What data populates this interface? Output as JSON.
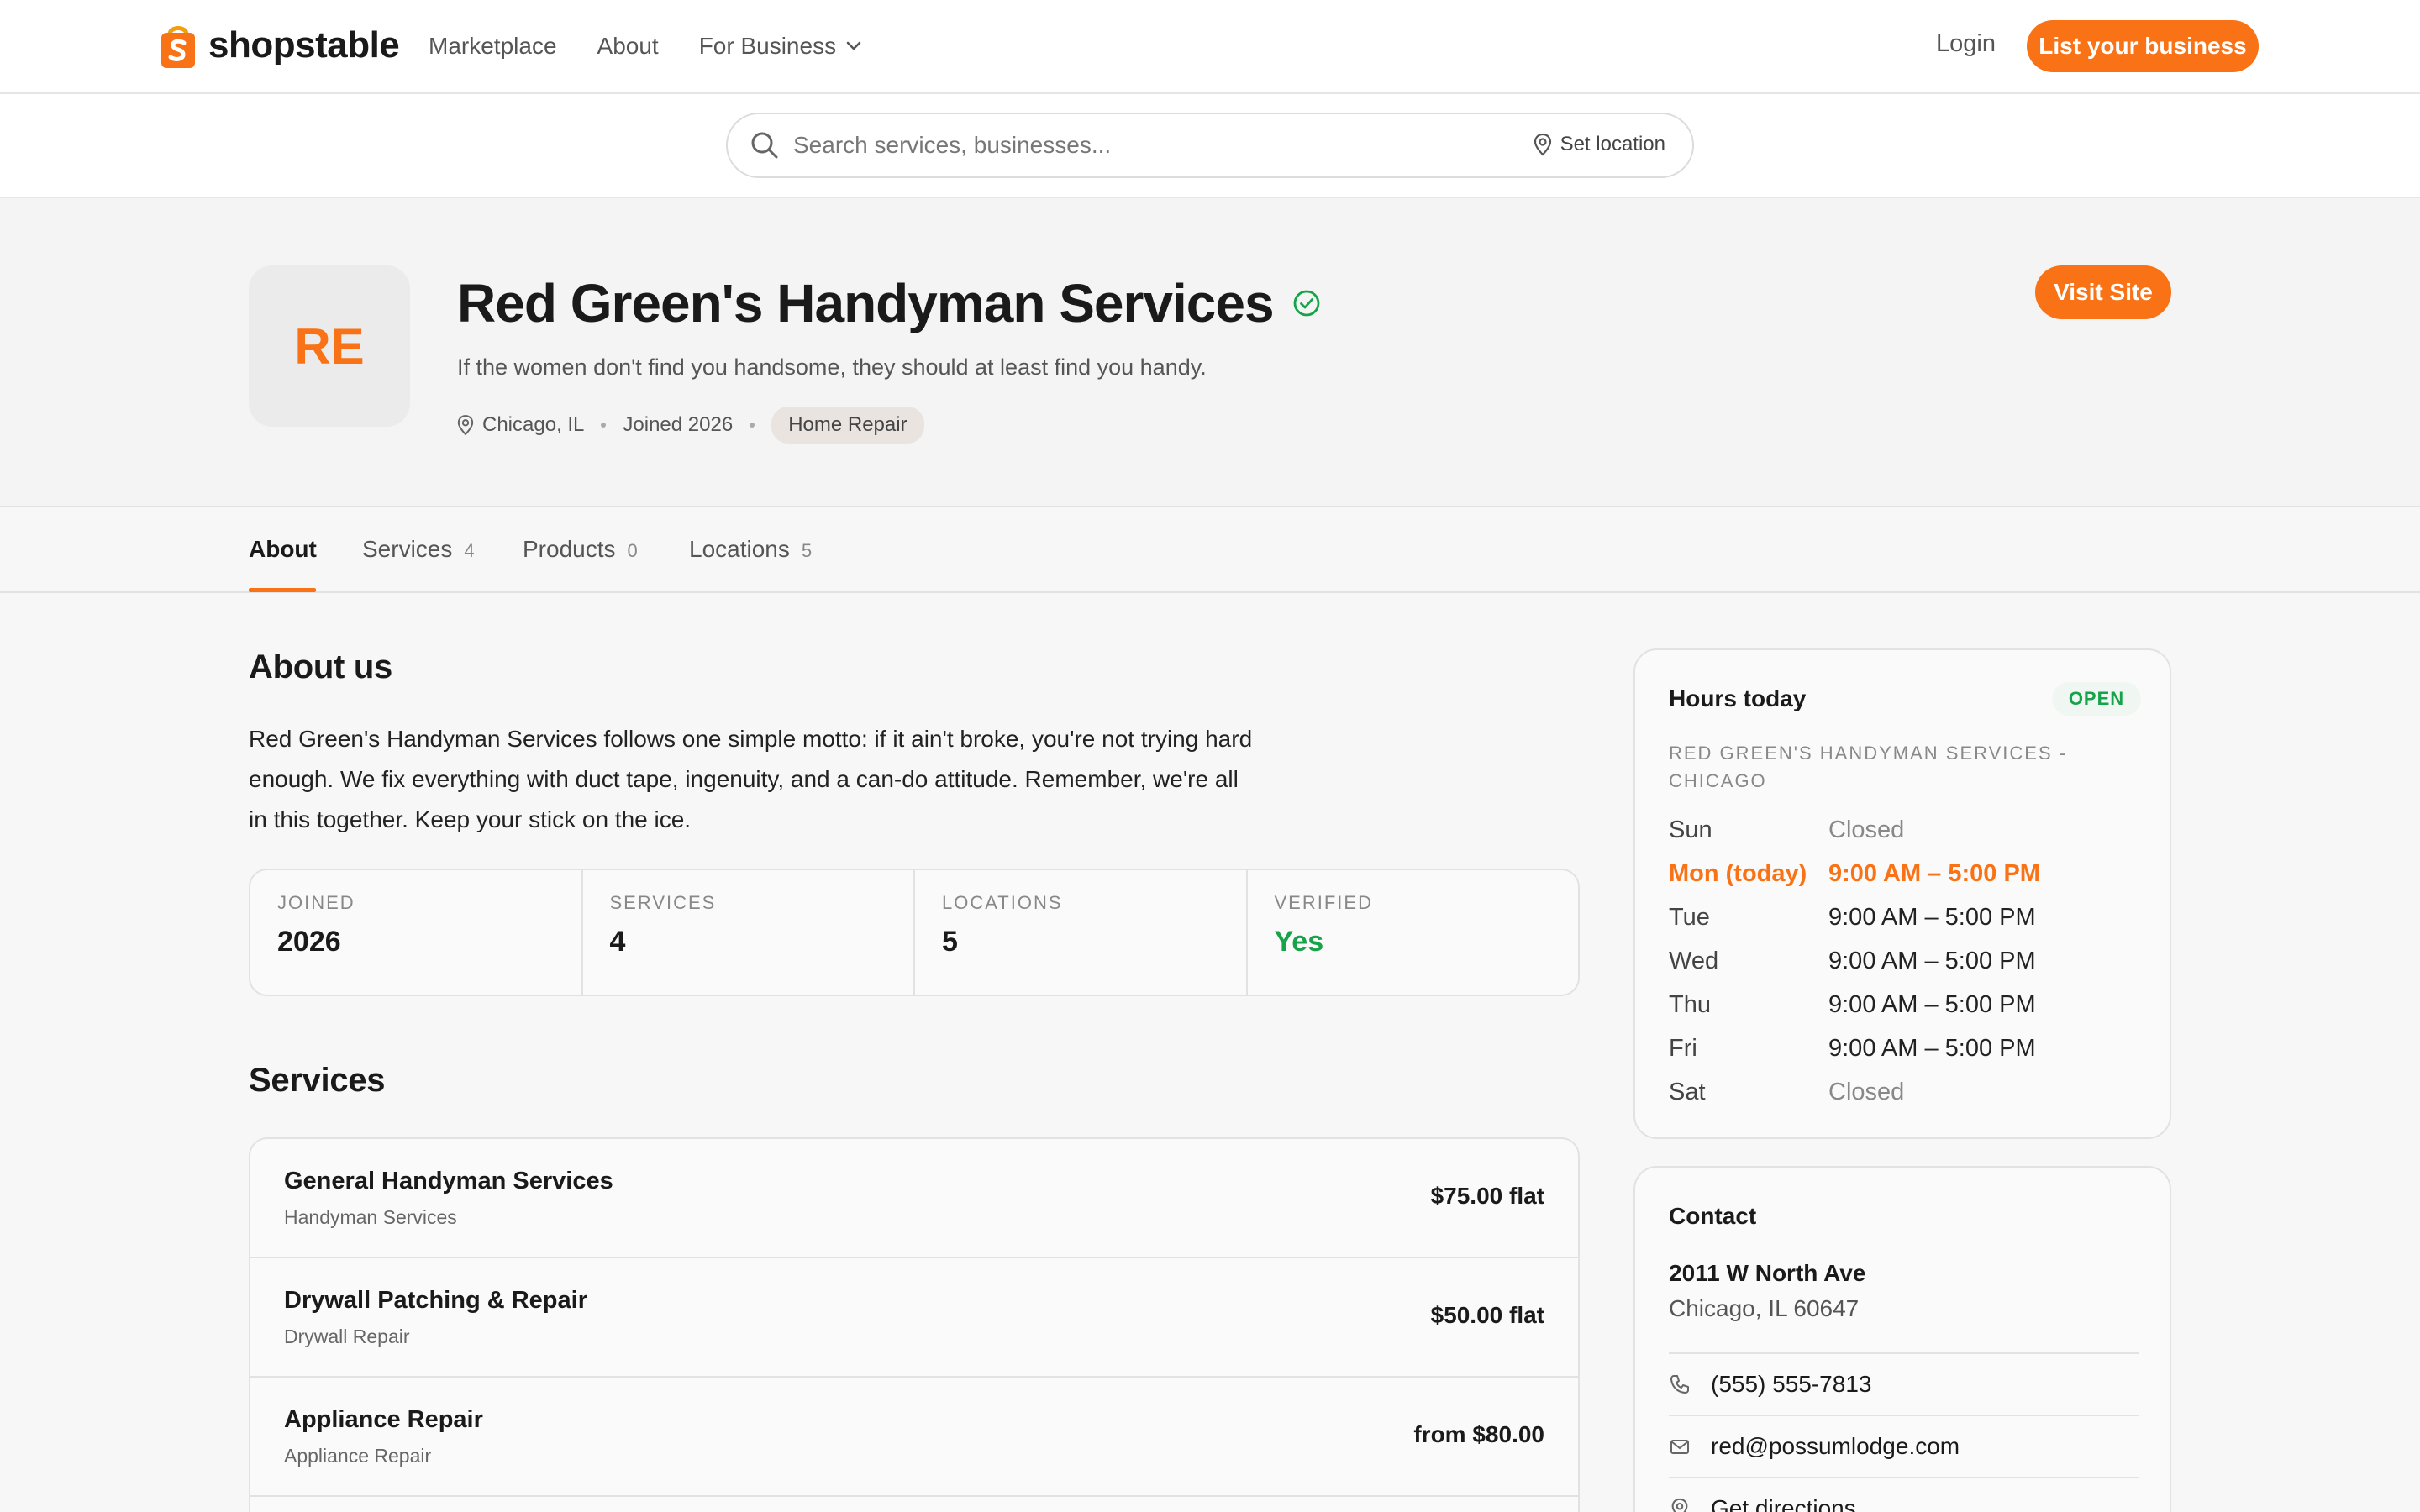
{
  "brand": {
    "name": "shopstable",
    "accent": "#f97316"
  },
  "nav": {
    "links": [
      "Marketplace",
      "About",
      "For Business"
    ],
    "login": "Login",
    "cta": "List your business"
  },
  "search": {
    "placeholder": "Search services, businesses...",
    "location": "Set location"
  },
  "business": {
    "initials": "RE",
    "name": "Red Green's Handyman Services",
    "verified": true,
    "tagline": "If the women don't find you handsome, they should at least find you handy.",
    "location": "Chicago, IL",
    "joined": "Joined 2026",
    "category": "Home Repair",
    "visit_label": "Visit Site"
  },
  "tabs": [
    {
      "label": "About",
      "count": ""
    },
    {
      "label": "Services",
      "count": "4"
    },
    {
      "label": "Products",
      "count": "0"
    },
    {
      "label": "Locations",
      "count": "5"
    }
  ],
  "about": {
    "title": "About us",
    "body": "Red Green's Handyman Services follows one simple motto: if it ain't broke, you're not trying hard enough. We fix everything with duct tape, ingenuity, and a can-do attitude. Remember, we're all in this together. Keep your stick on the ice."
  },
  "stats": [
    {
      "label": "JOINED",
      "value": "2026"
    },
    {
      "label": "SERVICES",
      "value": "4"
    },
    {
      "label": "LOCATIONS",
      "value": "5"
    },
    {
      "label": "VERIFIED",
      "value": "Yes"
    }
  ],
  "services": {
    "title": "Services",
    "items": [
      {
        "name": "General Handyman Services",
        "category": "Handyman Services",
        "price": "$75.00 flat"
      },
      {
        "name": "Drywall Patching & Repair",
        "category": "Drywall Repair",
        "price": "$50.00 flat"
      },
      {
        "name": "Appliance Repair",
        "category": "Appliance Repair",
        "price": "from $80.00"
      }
    ]
  },
  "hours": {
    "title": "Hours today",
    "status": "OPEN",
    "location": "RED GREEN'S HANDYMAN SERVICES - CHICAGO",
    "rows": [
      {
        "day": "Sun",
        "time": "Closed"
      },
      {
        "day": "Mon (today)",
        "time": "9:00 AM – 5:00 PM"
      },
      {
        "day": "Tue",
        "time": "9:00 AM – 5:00 PM"
      },
      {
        "day": "Wed",
        "time": "9:00 AM – 5:00 PM"
      },
      {
        "day": "Thu",
        "time": "9:00 AM – 5:00 PM"
      },
      {
        "day": "Fri",
        "time": "9:00 AM – 5:00 PM"
      },
      {
        "day": "Sat",
        "time": "Closed"
      }
    ]
  },
  "contact": {
    "title": "Contact",
    "address_line1": "2011 W North Ave",
    "address_line2": "Chicago, IL 60647",
    "phone": "(555) 555-7813",
    "email": "red@possumlodge.com",
    "directions": "Get directions"
  }
}
